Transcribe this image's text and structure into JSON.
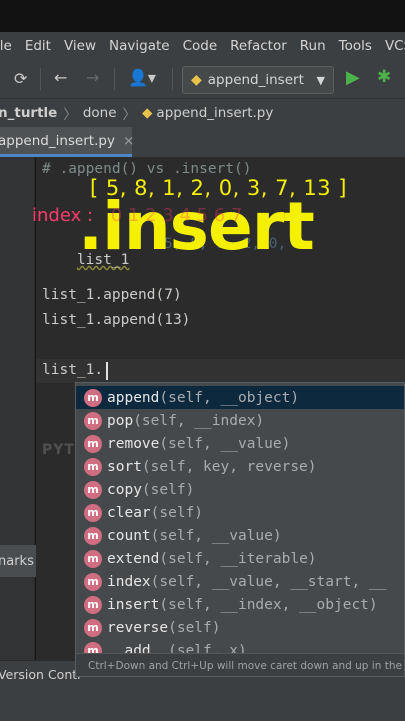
{
  "menu": [
    "ile",
    "Edit",
    "View",
    "Navigate",
    "Code",
    "Refactor",
    "Run",
    "Tools",
    "VCS"
  ],
  "toolbar": {
    "run_config": "append_insert"
  },
  "breadcrumb": {
    "project": "n_turtle",
    "folder": "done",
    "file": "append_insert.py"
  },
  "tab": {
    "label": "append_insert.py",
    "close": "×"
  },
  "code": {
    "comment": "# .append() vs .insert()",
    "line_list": "list_1",
    "line_list_rest": "5, 8, 1, 2, 0, 3",
    "append1": "list_1.append(7)",
    "append2": "list_1.append(13)",
    "current": "list_1."
  },
  "overlay": {
    "list": "[ 5, 8, 1, 2, 0, 3, 7, 13 ]",
    "index_label": "index :",
    "index_values": "0   1   2   3   4   5   6   7",
    "title": ".insert"
  },
  "watermark": "PYTHON TURTLE",
  "completion": {
    "items": [
      {
        "name": "append",
        "sig": "(self, __object)"
      },
      {
        "name": "pop",
        "sig": "(self, __index)"
      },
      {
        "name": "remove",
        "sig": "(self, __value)"
      },
      {
        "name": "sort",
        "sig": "(self, key, reverse)"
      },
      {
        "name": "copy",
        "sig": "(self)"
      },
      {
        "name": "clear",
        "sig": "(self)"
      },
      {
        "name": "count",
        "sig": "(self, __value)"
      },
      {
        "name": "extend",
        "sig": "(self, __iterable)"
      },
      {
        "name": "index",
        "sig": "(self, __value, __start, __"
      },
      {
        "name": "insert",
        "sig": "(self, __index, __object)"
      },
      {
        "name": "reverse",
        "sig": "(self)"
      },
      {
        "name": "__add__",
        "sig": "(self, x)"
      }
    ],
    "method_badge": "m",
    "hint": "Ctrl+Down and Ctrl+Up will move caret down and up in the edit"
  },
  "side": {
    "bookmarks": "narks",
    "version_control": "Version Contr"
  }
}
